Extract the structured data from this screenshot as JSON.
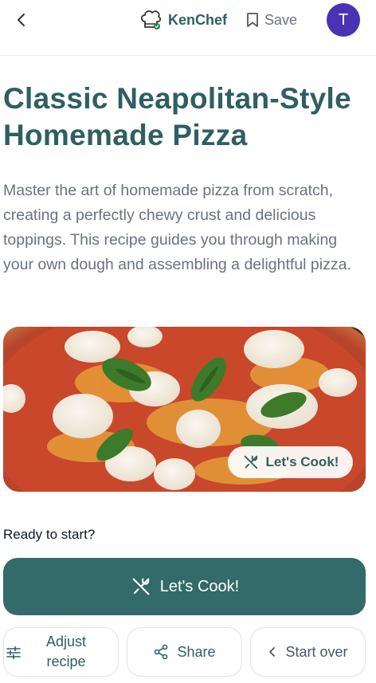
{
  "header": {
    "brand_name": "KenChef",
    "save_label": "Save",
    "avatar_initial": "T"
  },
  "recipe": {
    "title": "Classic Neapolitan-Style Homemade Pizza",
    "description": "Master the art of homemade pizza from scratch, creating a perfectly chewy crust and delicious toppings. This recipe guides you through making your own dough and assembling a delightful pizza.",
    "image_button_label": "Let's Cook!"
  },
  "actions": {
    "ready_text": "Ready to start?",
    "primary_label": "Let's Cook!",
    "adjust_label": "Adjust recipe",
    "share_label": "Share",
    "start_over_label": "Start over"
  },
  "colors": {
    "brand": "#2f5f61",
    "primary_button": "#336a6a",
    "avatar": "#4a32b4"
  },
  "icons": [
    "chevron-left-icon",
    "chef-hat-icon",
    "bookmark-icon",
    "utensils-crossed-icon",
    "sliders-icon",
    "share-icon"
  ]
}
